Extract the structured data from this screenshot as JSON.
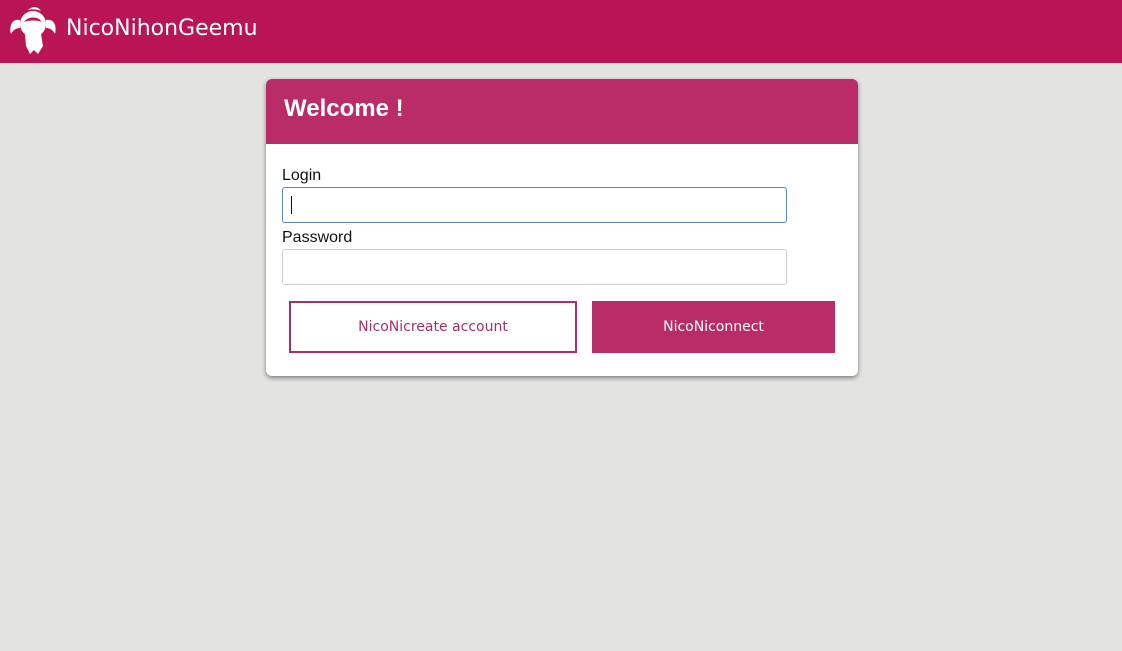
{
  "header": {
    "app_title": "NicoNihonGeemu",
    "logo_icon": "anime-girl-logo-icon",
    "background_color": "#b91453"
  },
  "login_card": {
    "title": "Welcome !",
    "header_color": "#b92c68",
    "login_label": "Login",
    "login_value": "",
    "password_label": "Password",
    "password_value": "",
    "create_account_label": "NicoNicreate account",
    "connect_label": "NicoNiconnect",
    "accent_color": "#a8306a"
  }
}
